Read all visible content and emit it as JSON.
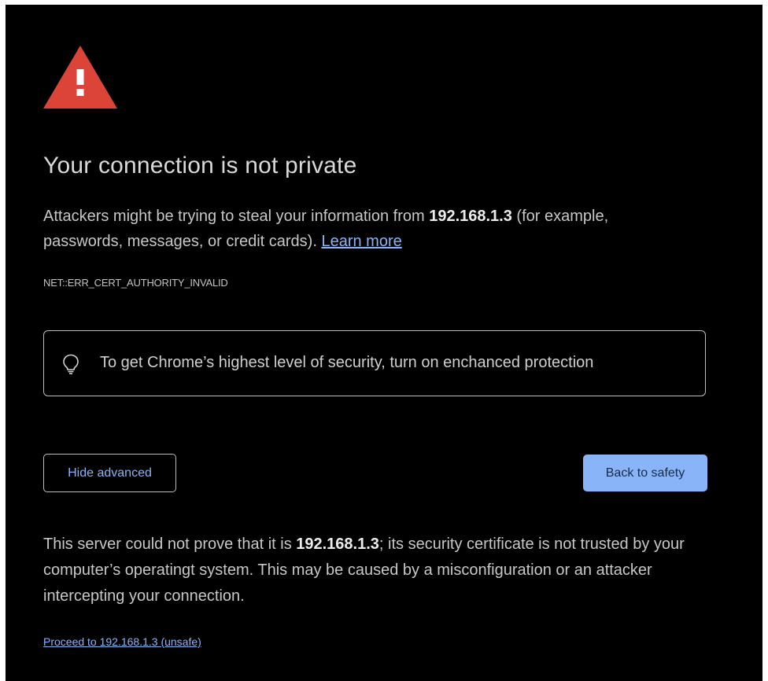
{
  "theme": {
    "background": "#000000",
    "text": "#c8c8c8",
    "link": "#8ab4f8",
    "primary_button": "#8ab4f8",
    "warning_icon": "#db4437"
  },
  "heading": {
    "icon": "warning-triangle-icon",
    "title": "Your connection is not private"
  },
  "explanation": {
    "part1": "Attackers might be trying to steal your information from ",
    "host": "192.168.1.3",
    "part2": " (for example, passwords, messages, or credit cards). ",
    "learn_more": "Learn more"
  },
  "error_code": "NET::ERR_CERT_AUTHORITY_INVALID",
  "promo": {
    "icon": "lightbulb-icon",
    "text": "To get Chrome’s highest level of security, turn on enchanced protection"
  },
  "buttons": {
    "hide_advanced": "Hide advanced",
    "back_to_safety": "Back to safety"
  },
  "details": {
    "part1": "This server could not prove that it is ",
    "host": "192.168.1.3",
    "part2": "; its security certificate is not trusted by your computer’s operatingt system. This may be caused by a misconfiguration or an attacker intercepting your connection."
  },
  "proceed_link": "Proceed to 192.168.1.3 (unsafe)"
}
